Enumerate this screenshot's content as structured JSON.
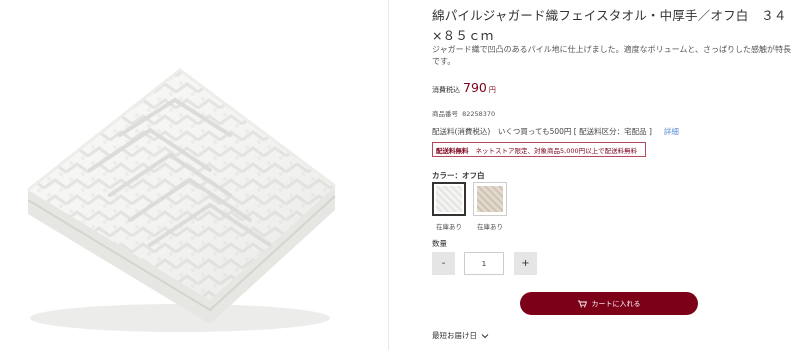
{
  "product": {
    "title": "綿パイルジャガード織フェイスタオル・中厚手／オフ白　３４×８５ｃｍ",
    "description": "ジャガード織で凹凸のあるパイル地に仕上げました。適度なボリュームと、さっぱりした感触が特長です。",
    "tax_label": "消費税込",
    "price": "790",
    "currency": "円",
    "product_no_label": "商品番号",
    "product_no": "82258370",
    "image_icon": "towel-photo"
  },
  "shipping": {
    "text": "配送料(消費税込)　いくつ買っても500円 [ 配送料区分：宅配品 ]",
    "detail_link": "詳細",
    "free_title": "配送料無料",
    "free_note": "ネットストア限定、対象商品5,000円以上で配送料無料"
  },
  "color": {
    "label": "カラー：オフ白",
    "options": [
      {
        "name": "off-white",
        "stock": "在庫あり",
        "color": "#f1f1ef",
        "selected": true
      },
      {
        "name": "beige",
        "stock": "在庫あり",
        "color": "#ddd4c6",
        "selected": false
      }
    ]
  },
  "quantity": {
    "label": "数量",
    "minus": "-",
    "value": "1",
    "plus": "+"
  },
  "cart": {
    "label": "カートに入れる",
    "icon": "cart-icon",
    "color": "#7d0019"
  },
  "delivery": {
    "label": "最短お届け日",
    "icon": "chevron-down-icon"
  }
}
